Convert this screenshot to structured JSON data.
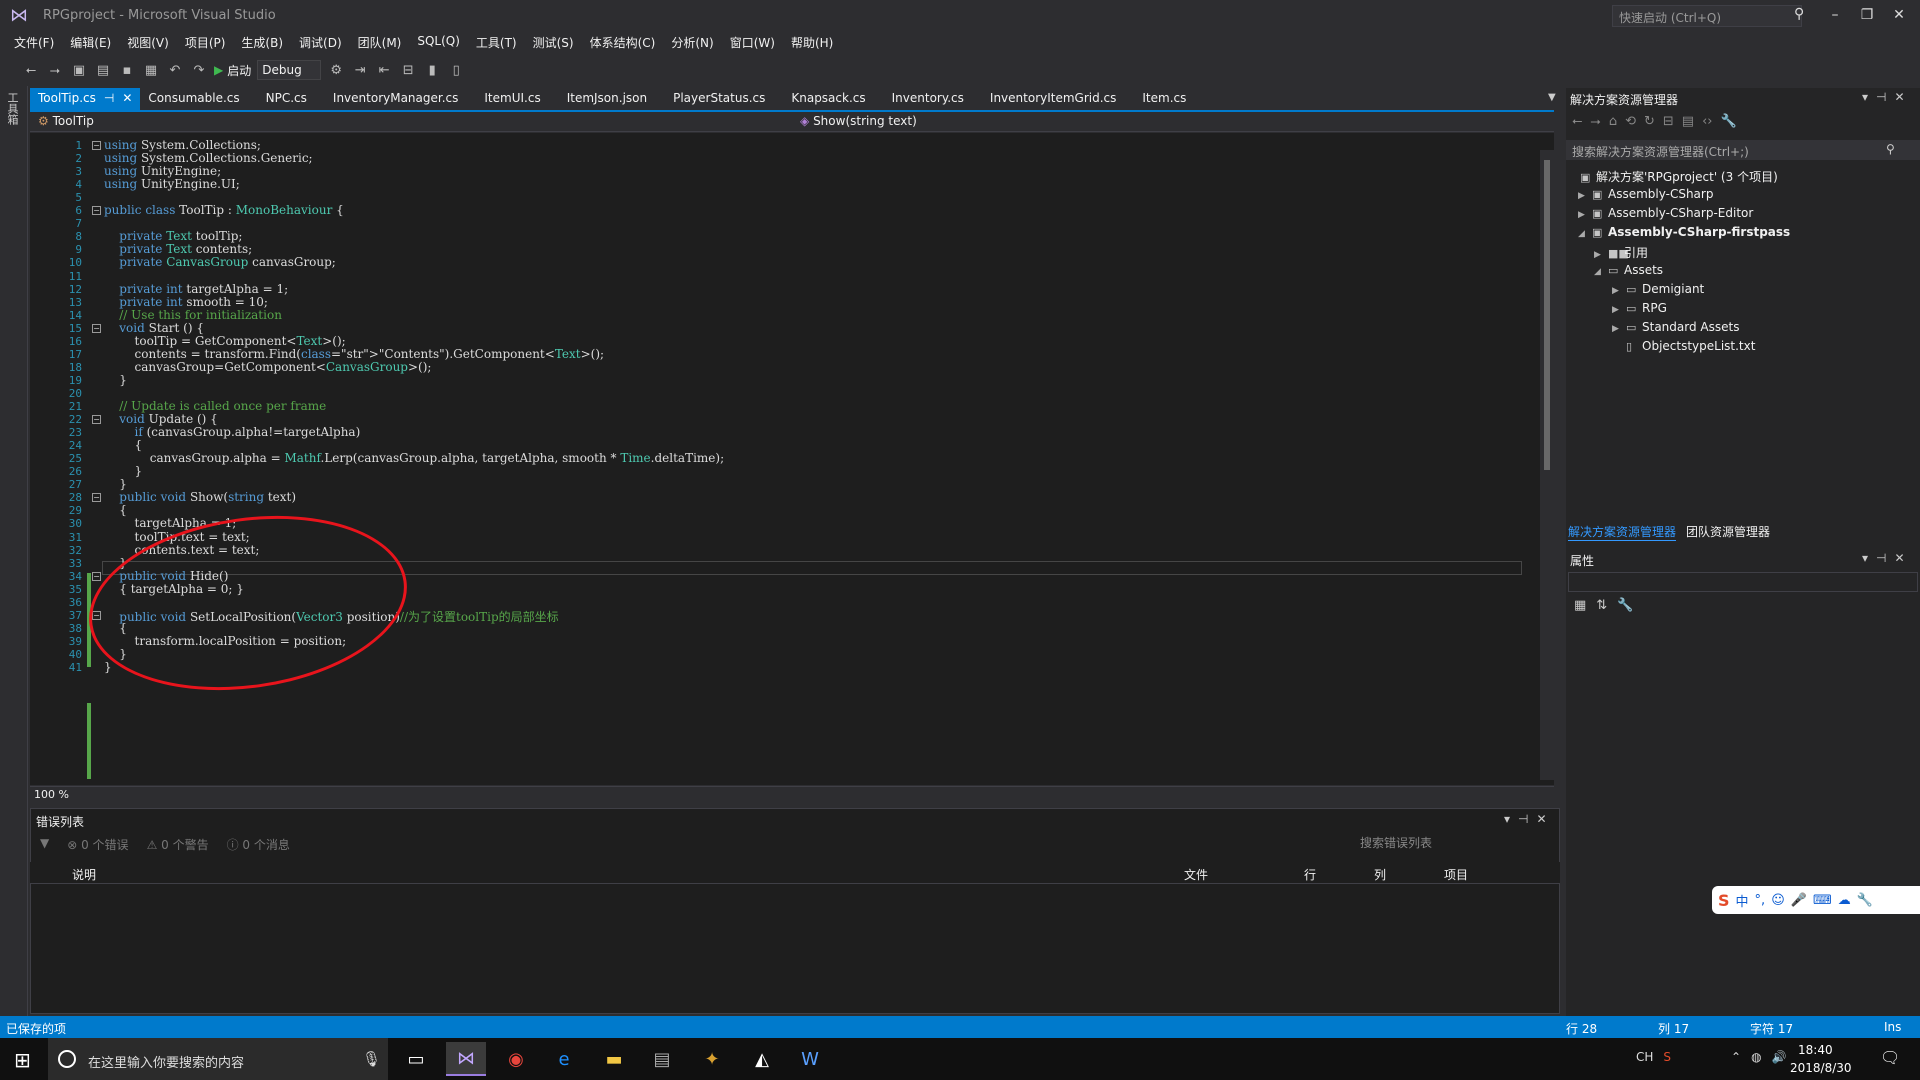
{
  "window": {
    "title": "RPGproject - Microsoft Visual Studio",
    "quick_launch": "快速启动 (Ctrl+Q)"
  },
  "menu": [
    "文件(F)",
    "编辑(E)",
    "视图(V)",
    "项目(P)",
    "生成(B)",
    "调试(D)",
    "团队(M)",
    "SQL(Q)",
    "工具(T)",
    "测试(S)",
    "体系结构(C)",
    "分析(N)",
    "窗口(W)",
    "帮助(H)"
  ],
  "toolbar": {
    "start_label": "启动",
    "config": "Debug"
  },
  "left_rail_label": "工具箱",
  "tabs": [
    "ToolTip.cs",
    "Consumable.cs",
    "NPC.cs",
    "InventoryManager.cs",
    "ItemUI.cs",
    "ItemJson.json",
    "PlayerStatus.cs",
    "Knapsack.cs",
    "Inventory.cs",
    "InventoryItemGrid.cs",
    "Item.cs"
  ],
  "navbar": {
    "class": "ToolTip",
    "method": "Show(string text)"
  },
  "editor": {
    "zoom": "100 %",
    "line_numbers": [
      "1",
      "2",
      "3",
      "4",
      "5",
      "6",
      "7",
      "8",
      "9",
      "10",
      "11",
      "12",
      "13",
      "14",
      "15",
      "16",
      "17",
      "18",
      "19",
      "20",
      "21",
      "22",
      "23",
      "24",
      "25",
      "26",
      "27",
      "28",
      "29",
      "30",
      "31",
      "32",
      "33",
      "34",
      "35",
      "36",
      "37",
      "38",
      "39",
      "40",
      "41"
    ],
    "lines": [
      "using System.Collections;",
      "using System.Collections.Generic;",
      "using UnityEngine;",
      "using UnityEngine.UI;",
      "",
      "public class ToolTip : MonoBehaviour {",
      "",
      "    private Text toolTip;",
      "    private Text contents;",
      "    private CanvasGroup canvasGroup;",
      "",
      "    private int targetAlpha = 1;",
      "    private int smooth = 10;",
      "    // Use this for initialization",
      "    void Start () {",
      "        toolTip = GetComponent<Text>();",
      "        contents = transform.Find(\"Contents\").GetComponent<Text>();",
      "        canvasGroup=GetComponent<CanvasGroup>();",
      "    }",
      "",
      "    // Update is called once per frame",
      "    void Update () {",
      "        if (canvasGroup.alpha!=targetAlpha)",
      "        {",
      "            canvasGroup.alpha = Mathf.Lerp(canvasGroup.alpha, targetAlpha, smooth * Time.deltaTime);",
      "        }",
      "    }",
      "    public void Show(string text)",
      "    {",
      "        targetAlpha = 1;",
      "        toolTip.text = text;",
      "        contents.text = text;",
      "    }",
      "    public void Hide()",
      "    { targetAlpha = 0; }",
      "",
      "    public void SetLocalPosition(Vector3 position)//为了设置toolTip的局部坐标",
      "    {",
      "        transform.localPosition = position;",
      "    }",
      "}"
    ]
  },
  "error_list": {
    "title": "错误列表",
    "errors": "0 个错误",
    "warnings": "0 个警告",
    "messages": "0 个消息",
    "search_placeholder": "搜索错误列表",
    "columns": [
      "说明",
      "文件",
      "行",
      "列",
      "项目"
    ]
  },
  "solution_explorer": {
    "title": "解决方案资源管理器",
    "search_placeholder": "搜索解决方案资源管理器(Ctrl+;)",
    "tree": [
      "解决方案'RPGproject' (3 个项目)",
      "Assembly-CSharp",
      "Assembly-CSharp-Editor",
      "Assembly-CSharp-firstpass",
      "引用",
      "Assets",
      "Demigiant",
      "RPG",
      "Standard Assets",
      "ObjectstypeList.txt"
    ],
    "bottom_tabs": [
      "解决方案资源管理器",
      "团队资源管理器"
    ]
  },
  "properties": {
    "title": "属性"
  },
  "ime": {
    "lang": "中"
  },
  "status": {
    "message": "已保存的项",
    "line": "行 28",
    "col": "列 17",
    "char": "字符 17",
    "mode": "Ins"
  },
  "taskbar": {
    "search_placeholder": "在这里输入你要搜索的内容",
    "time": "18:40",
    "date": "2018/8/30",
    "lang": "CH"
  }
}
